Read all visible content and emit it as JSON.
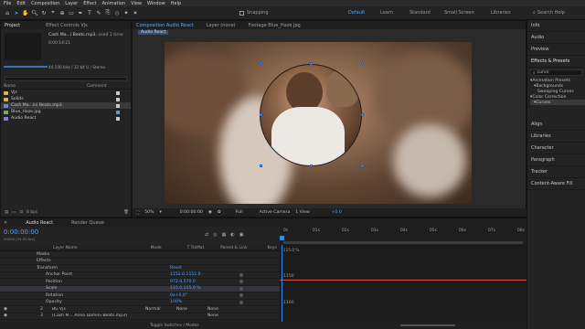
{
  "menu": [
    "File",
    "Edit",
    "Composition",
    "Layer",
    "Effect",
    "Animation",
    "View",
    "Window",
    "Help"
  ],
  "toolbar": {
    "snapping_label": "Snapping",
    "workspaces": [
      "Default",
      "Learn",
      "Standard",
      "Small Screen",
      "Libraries"
    ],
    "active_workspace": "Default",
    "search_placeholder": "Search Help"
  },
  "project_panel": {
    "tabs": [
      "Project",
      "Effect Controls Vjs"
    ],
    "selected_item": "Cash Ma...i Beats.mp3",
    "selected_meta": ", used 1 time",
    "duration": "0:00:14:21",
    "audio_info": "44.100 kHz / 32 bit U / Stereo",
    "search_placeholder": "",
    "columns": {
      "name": "Name",
      "comment": "Comment"
    },
    "items": [
      {
        "name": "Vjs",
        "type": "folder",
        "swatch": "#c9c9c9"
      },
      {
        "name": "Solids",
        "type": "folder",
        "swatch": "#c9c9c9"
      },
      {
        "name": "Cash Ma...ini Beats.mp3",
        "type": "media",
        "swatch": "#c9c9c9",
        "selected": true
      },
      {
        "name": "Blue_Haze.jpg",
        "type": "img",
        "swatch": "#6f8fd1"
      },
      {
        "name": "Audio React",
        "type": "comp",
        "swatch": "#c9c9c9"
      }
    ],
    "footer_bpc": "8 bpc"
  },
  "viewer": {
    "tabs": [
      {
        "label": "Composition Audio React",
        "active": true
      },
      {
        "label": "Layer (none)",
        "active": false
      },
      {
        "label": "Footage Blue_Haze.jpg",
        "active": false
      }
    ],
    "sub_tab": "Audio React",
    "zoom": "50%",
    "timecode": "0:00:00:00",
    "resolution": "Full",
    "camera": "Active Camera",
    "views": "1 View",
    "extra": "+0.0"
  },
  "right_panel": {
    "items": [
      "Info",
      "Audio",
      "Preview",
      "Effects & Presets"
    ],
    "search_value": "curve",
    "tree": [
      {
        "label": "Animation Presets",
        "level": 0
      },
      {
        "label": "Backgrounds",
        "level": 1
      },
      {
        "label": "Swooping Curves",
        "level": 2
      },
      {
        "label": "Color Correction",
        "level": 0
      },
      {
        "label": "Curves",
        "level": 1,
        "selected": true
      }
    ],
    "more": [
      "Align",
      "Libraries",
      "Character",
      "Paragraph",
      "Tracker",
      "Content-Aware Fill"
    ]
  },
  "timeline": {
    "tabs": [
      "Audio React",
      "Render Queue"
    ],
    "timecode": "0:00:00:00",
    "timecode_sub": "00000 (25.00 fps)",
    "columns": {
      "layer_name": "Layer Name",
      "mode": "Mode",
      "trkmat": "T TrkMat",
      "parent": "Parent & Link",
      "keys": "Keys"
    },
    "properties": [
      {
        "name": "Masks",
        "indent": 1,
        "value": ""
      },
      {
        "name": "Effects",
        "indent": 1,
        "value": ""
      },
      {
        "name": "Transform",
        "indent": 1,
        "value": "Reset"
      },
      {
        "name": "Anchor Point",
        "indent": 2,
        "value": "1152.0,1152.0"
      },
      {
        "name": "Position",
        "indent": 2,
        "value": "972.0,570.0"
      },
      {
        "name": "Scale",
        "indent": 2,
        "value": "115.0,115.0 %",
        "selected": true
      },
      {
        "name": "Rotation",
        "indent": 2,
        "value": "0x+0.0°"
      },
      {
        "name": "Opacity",
        "indent": 2,
        "value": "100%"
      }
    ],
    "layers": [
      {
        "num": "2",
        "name": "BG Vjs",
        "mode": "Normal",
        "trkmat": "None",
        "parent": "None"
      },
      {
        "num": "3",
        "name": "[Cash M... Anno Domini Beats.mp3]",
        "mode": "",
        "trkmat": "",
        "parent": "None"
      }
    ],
    "ruler": [
      "0s",
      "01s",
      "02s",
      "03s",
      "04s",
      "05s",
      "06s",
      "07s",
      "08s"
    ],
    "graph_labels": {
      "top": "115.0 %",
      "mid": "1150",
      "bottom": "1160"
    },
    "footer": "Toggle Switches / Modes"
  },
  "colors": {
    "accent": "#2d8ceb",
    "graph_line": "#e0533a",
    "timeline_line": "#2d8ceb"
  }
}
